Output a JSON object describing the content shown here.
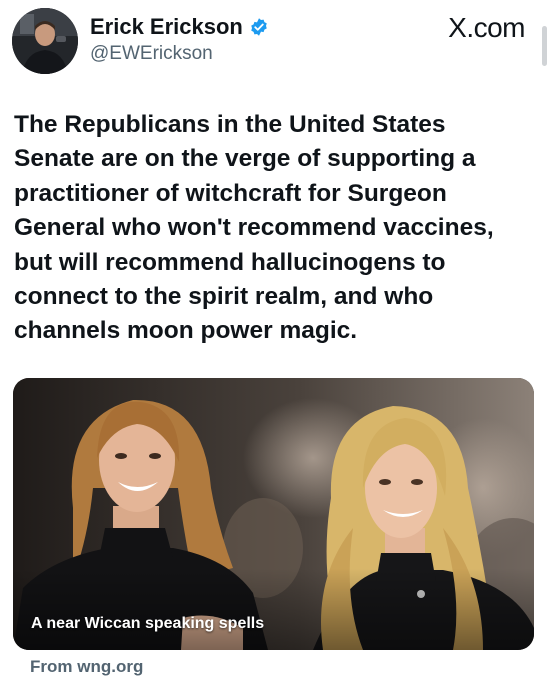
{
  "author": {
    "display_name": "Erick Erickson",
    "handle": "@EWErickson",
    "verified": true,
    "verified_color": "#1d9bf0"
  },
  "source_brand": "X.com",
  "post": {
    "text": "The Republicans in the United States Senate are on the verge of supporting a practitioner of witchcraft for Surgeon General who won't recommend vaccines, but will recommend hallucinogens to connect to the spirit realm, and who channels moon power magic."
  },
  "media": {
    "caption": "A near Wiccan speaking spells",
    "link_source": "From wng.org"
  },
  "icons": {
    "verified": "verified-badge-icon"
  }
}
